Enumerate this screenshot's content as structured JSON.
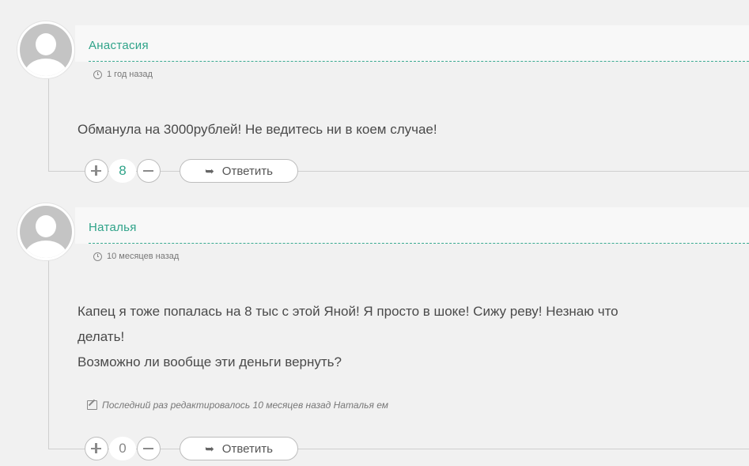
{
  "comments": [
    {
      "author": "Анастасия",
      "time": "1 год назад",
      "text_lines": [
        "Обманула на 3000рублей! Не ведитесь ни в коем случае!"
      ],
      "votes": "8",
      "reply_label": "Ответить",
      "reply_icon": "➥"
    },
    {
      "author": "Наталья",
      "time": "10 месяцев назад",
      "text_lines": [
        "Капец я тоже попалась на 8 тыс с этой Яной! Я просто в шоке! Сижу реву! Незнаю что",
        "делать!",
        "Возможно ли вообще эти деньги вернуть?"
      ],
      "edited_note": "Последний раз редактировалось 10 месяцев назад Наталья ем",
      "votes": "0",
      "reply_label": "Ответить",
      "reply_icon": "➥"
    }
  ],
  "colors": {
    "accent": "#2fa389",
    "background": "#f1f1f1"
  }
}
